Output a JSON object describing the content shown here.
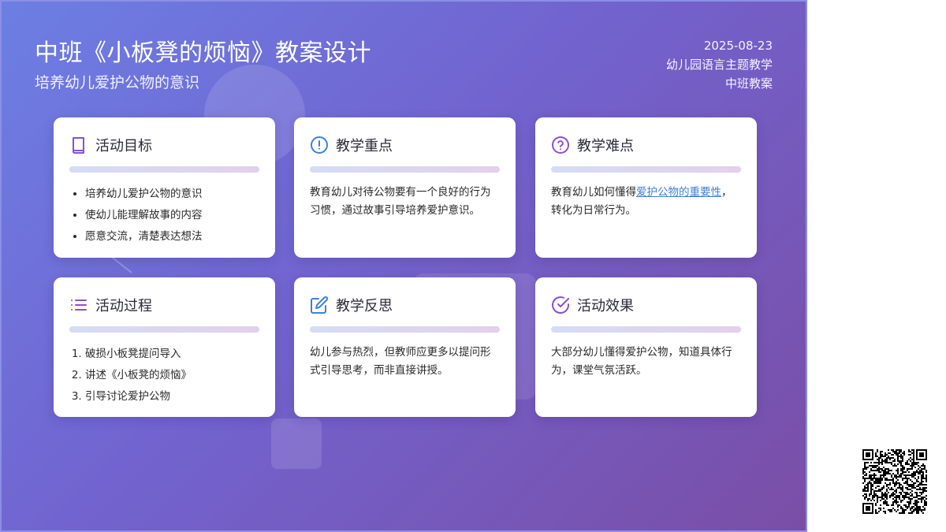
{
  "header": {
    "title": "中班《小板凳的烦恼》教案设计",
    "subtitle": "培养幼儿爱护公物的意识",
    "date": "2025-08-23",
    "theme": "幼儿园语言主题教学",
    "grade": "中班教案"
  },
  "colors": {
    "gradient_start": "#6c7fe3",
    "gradient_end": "#7a4ea6",
    "icon_purple": "#8a4fd6",
    "icon_blue": "#3f7fd8",
    "link": "#3f7fd8"
  },
  "cards": {
    "goals": {
      "icon": "book-icon",
      "title": "活动目标",
      "items": [
        "培养幼儿爱护公物的意识",
        "使幼儿能理解故事的内容",
        "愿意交流，清楚表达想法"
      ]
    },
    "key_points": {
      "icon": "alert-circle-icon",
      "title": "教学重点",
      "text": "教育幼儿对待公物要有一个良好的行为习惯，通过故事引导培养爱护意识。"
    },
    "difficulties": {
      "icon": "help-circle-icon",
      "title": "教学难点",
      "text_before": "教育幼儿如何懂得",
      "link": "爱护公物的重要性",
      "text_after": "，转化为日常行为。"
    },
    "process": {
      "icon": "list-icon",
      "title": "活动过程",
      "items": [
        "破损小板凳提问导入",
        "讲述《小板凳的烦恼》",
        "引导讨论爱护公物"
      ]
    },
    "reflection": {
      "icon": "edit-icon",
      "title": "教学反思",
      "text": "幼儿参与热烈，但教师应更多以提问形式引导思考，而非直接讲授。"
    },
    "effect": {
      "icon": "check-circle-icon",
      "title": "活动效果",
      "text": "大部分幼儿懂得爱护公物，知道具体行为，课堂气氛活跃。"
    }
  }
}
